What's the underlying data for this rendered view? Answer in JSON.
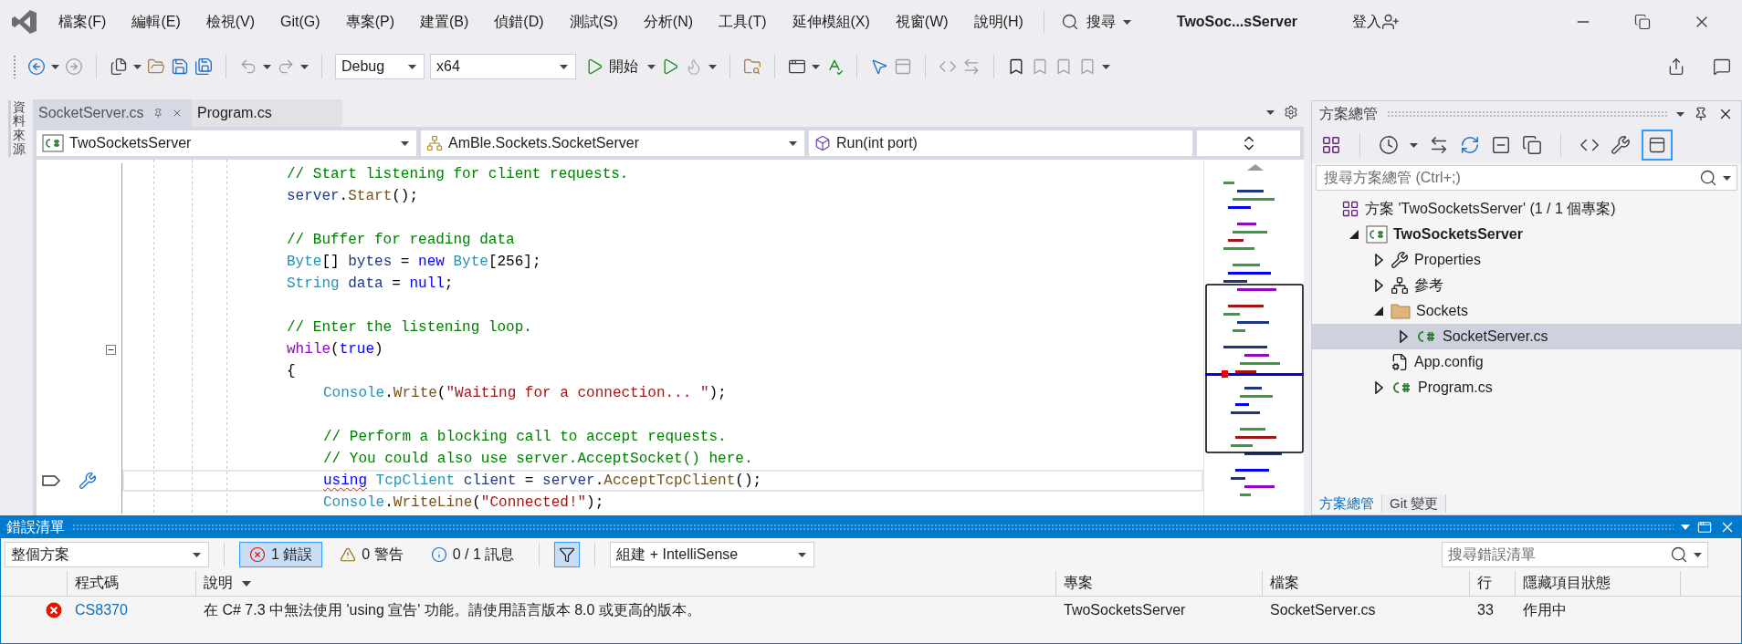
{
  "menu_bar": {
    "items": [
      "檔案(F)",
      "編輯(E)",
      "檢視(V)",
      "Git(G)",
      "專案(P)",
      "建置(B)",
      "偵錯(D)",
      "測試(S)",
      "分析(N)",
      "工具(T)",
      "延伸模組(X)",
      "視窗(W)",
      "說明(H)"
    ],
    "search": "搜尋",
    "title": "TwoSoc...sServer",
    "sign_in": "登入"
  },
  "toolbar": {
    "configuration": "Debug",
    "platform": "x64",
    "start": "開始"
  },
  "side_strip": {
    "label": "資料來源"
  },
  "editor": {
    "tabs": [
      {
        "label": "SocketServer.cs",
        "selected": true
      },
      {
        "label": "Program.cs",
        "selected": false
      }
    ],
    "navigation": {
      "project": "TwoSocketsServer",
      "type": "AmBle.Sockets.SocketServer",
      "member": "Run(int port)"
    },
    "lines": [
      {
        "current": false,
        "indented": false,
        "tokens": [
          {
            "kind": "comment",
            "text": "// Start listening for client requests."
          }
        ]
      },
      {
        "current": false,
        "indented": false,
        "tokens": [
          {
            "kind": "ident",
            "text": "server"
          },
          {
            "kind": "punct",
            "text": "."
          },
          {
            "kind": "method",
            "text": "Start"
          },
          {
            "kind": "punct",
            "text": "();"
          }
        ]
      },
      {
        "current": false,
        "indented": false,
        "blank_before": true,
        "tokens": [
          {
            "kind": "comment",
            "text": "// Buffer for reading data"
          }
        ]
      },
      {
        "current": false,
        "indented": false,
        "tokens": [
          {
            "kind": "type",
            "text": "Byte"
          },
          {
            "kind": "punct",
            "text": "[] "
          },
          {
            "kind": "ident",
            "text": "bytes"
          },
          {
            "kind": "punct",
            "text": " = "
          },
          {
            "kind": "keyword",
            "text": "new"
          },
          {
            "kind": "type",
            "text": " Byte"
          },
          {
            "kind": "punct",
            "text": "[256];"
          }
        ]
      },
      {
        "current": false,
        "indented": false,
        "tokens": [
          {
            "kind": "type",
            "text": "String"
          },
          {
            "kind": "ident",
            "text": " data"
          },
          {
            "kind": "punct",
            "text": " = "
          },
          {
            "kind": "keyword",
            "text": "null"
          },
          {
            "kind": "punct",
            "text": ";"
          }
        ]
      },
      {
        "current": false,
        "indented": false,
        "blank_before": true,
        "tokens": [
          {
            "kind": "comment",
            "text": "// Enter the listening loop."
          }
        ]
      },
      {
        "current": false,
        "indented": false,
        "collapsible": true,
        "tokens": [
          {
            "kind": "control",
            "text": "while"
          },
          {
            "kind": "punct",
            "text": "("
          },
          {
            "kind": "keyword",
            "text": "true"
          },
          {
            "kind": "punct",
            "text": ")"
          }
        ]
      },
      {
        "current": false,
        "indented": false,
        "tokens": [
          {
            "kind": "punct",
            "text": "{"
          }
        ]
      },
      {
        "current": false,
        "indented": true,
        "tokens": [
          {
            "kind": "type",
            "text": "Console"
          },
          {
            "kind": "punct",
            "text": "."
          },
          {
            "kind": "method",
            "text": "Write"
          },
          {
            "kind": "punct",
            "text": "("
          },
          {
            "kind": "string",
            "text": "\"Waiting for a connection... \""
          },
          {
            "kind": "punct",
            "text": ");"
          }
        ]
      },
      {
        "current": false,
        "indented": true,
        "blank_before": true,
        "tokens": [
          {
            "kind": "comment",
            "text": "// Perform a blocking call to accept requests."
          }
        ]
      },
      {
        "current": false,
        "indented": true,
        "tokens": [
          {
            "kind": "comment",
            "text": "// You could also use server.AcceptSocket() here."
          }
        ]
      },
      {
        "current": true,
        "indented": true,
        "tokens": [
          {
            "kind": "keyword",
            "text": "using",
            "squiggle": true
          },
          {
            "kind": "type",
            "text": " TcpClient"
          },
          {
            "kind": "ident",
            "text": " client"
          },
          {
            "kind": "punct",
            "text": " = "
          },
          {
            "kind": "ident",
            "text": "server"
          },
          {
            "kind": "punct",
            "text": "."
          },
          {
            "kind": "method",
            "text": "AcceptTcpClient"
          },
          {
            "kind": "punct",
            "text": "();"
          }
        ]
      },
      {
        "current": false,
        "indented": true,
        "tokens": [
          {
            "kind": "type",
            "text": "Console"
          },
          {
            "kind": "punct",
            "text": "."
          },
          {
            "kind": "method",
            "text": "WriteLine"
          },
          {
            "kind": "punct",
            "text": "("
          },
          {
            "kind": "string",
            "text": "\"Connected!\""
          },
          {
            "kind": "punct",
            "text": ");"
          }
        ]
      }
    ]
  },
  "solution_explorer": {
    "title": "方案總管",
    "search": {
      "placeholder": "搜尋方案總管 (Ctrl+;)"
    },
    "tree": [
      {
        "label": "方案 'TwoSocketsServer' (1 / 1 個專案)",
        "kind": "solution",
        "selected": false,
        "children": [
          {
            "label": "TwoSocketsServer",
            "kind": "project",
            "expanded": true,
            "selected": false,
            "children": [
              {
                "label": "Properties",
                "kind": "properties",
                "expanded": false,
                "selected": false
              },
              {
                "label": "參考",
                "kind": "references",
                "expanded": false,
                "selected": false
              },
              {
                "label": "Sockets",
                "kind": "folder",
                "expanded": true,
                "selected": false,
                "children": [
                  {
                    "label": "SocketServer.cs",
                    "kind": "csharp",
                    "expanded": false,
                    "selected": true
                  }
                ]
              },
              {
                "label": "App.config",
                "kind": "config",
                "selected": false
              },
              {
                "label": "Program.cs",
                "kind": "csharp",
                "expanded": false,
                "selected": false
              }
            ]
          }
        ]
      }
    ],
    "tabs": [
      {
        "label": "方案總管",
        "selected": true
      },
      {
        "label": "Git 變更",
        "selected": false
      }
    ]
  },
  "error_list": {
    "title": "錯誤清單",
    "scope": "整個方案",
    "filters": [
      {
        "label": "1 錯誤",
        "kind": "error",
        "selected": true
      },
      {
        "label": "0 警告",
        "kind": "warning",
        "selected": false
      },
      {
        "label": "0 / 1 訊息",
        "kind": "message",
        "selected": false
      }
    ],
    "filter_toggle": {
      "on": true
    },
    "source": "組建 + IntelliSense",
    "search": {
      "placeholder": "搜尋錯誤清單"
    },
    "columns": [
      {
        "label": "程式碼",
        "sorted": false
      },
      {
        "label": "說明",
        "sorted": true
      },
      {
        "label": "專案",
        "sorted": false
      },
      {
        "label": "檔案",
        "sorted": false
      },
      {
        "label": "行",
        "sorted": false
      },
      {
        "label": "隱藏項目狀態",
        "sorted": false
      }
    ],
    "rows": [
      {
        "kind": "error",
        "code": "CS8370",
        "description": "在 C# 7.3 中無法使用 'using 宣告' 功能。請使用語言版本 8.0 或更高的版本。",
        "project": "TwoSocketsServer",
        "file": "SocketServer.cs",
        "line": "33",
        "suppression": "作用中"
      }
    ]
  }
}
